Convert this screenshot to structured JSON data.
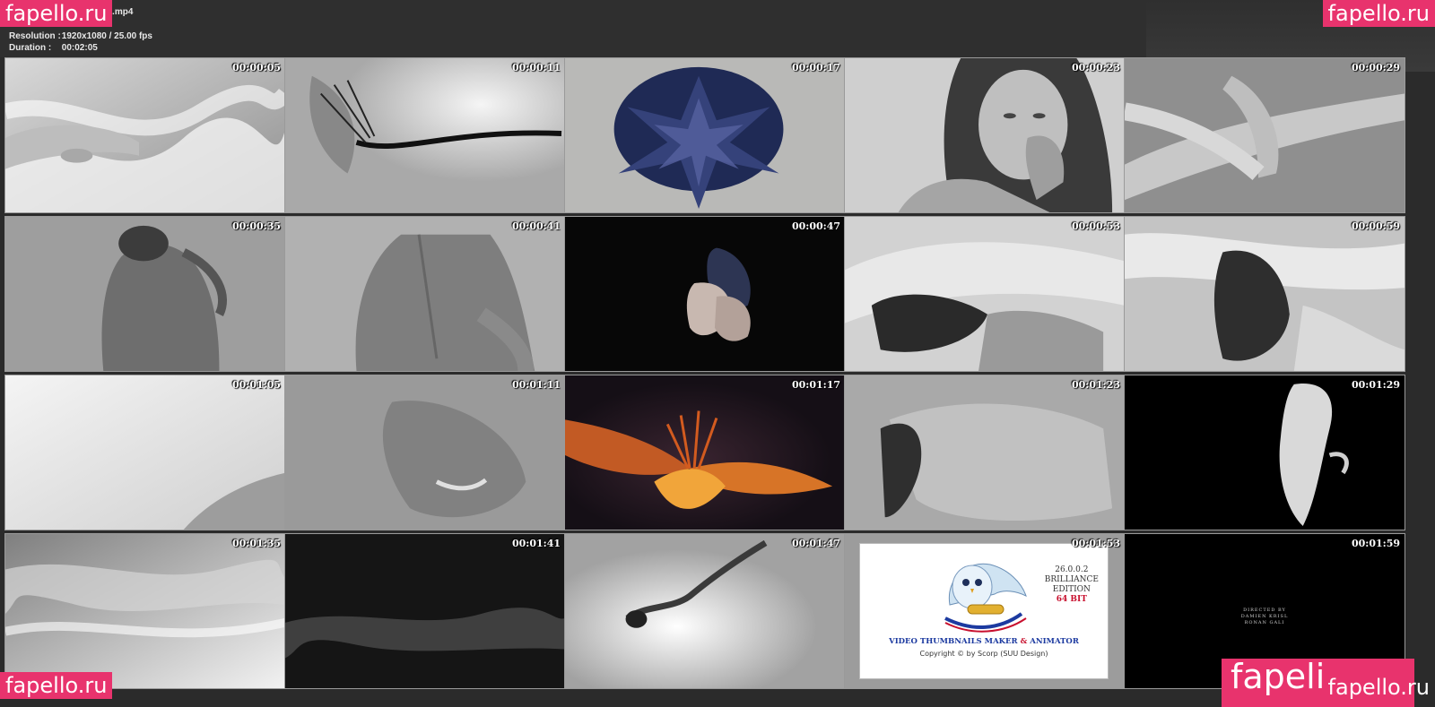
{
  "header": {
    "title": "...ayed Life - Lorena Rae.mp4",
    "resolution_label": "Resolution :",
    "resolution_value": "1920x1080 / 25.00 fps",
    "duration_label": "Duration :",
    "duration_value": "00:02:05"
  },
  "watermarks": {
    "top_left": "fapello.ru",
    "top_right": "fapello.ru",
    "bottom_left": "fapello.ru",
    "bottom_right_big": "fapeli",
    "bottom_right_small": "fapello.ru"
  },
  "thumbnails": [
    {
      "time": "00:00:05",
      "scene": "white-silk-hand"
    },
    {
      "time": "00:00:11",
      "scene": "bw-flower-stem"
    },
    {
      "time": "00:00:17",
      "scene": "blue-chrysanthemum"
    },
    {
      "time": "00:00:23",
      "scene": "bw-portrait"
    },
    {
      "time": "00:00:29",
      "scene": "bw-arms"
    },
    {
      "time": "00:00:35",
      "scene": "bw-back"
    },
    {
      "time": "00:00:41",
      "scene": "bw-back-2"
    },
    {
      "time": "00:00:47",
      "scene": "petal-on-black"
    },
    {
      "time": "00:00:53",
      "scene": "bw-fabric-face"
    },
    {
      "time": "00:00:59",
      "scene": "bw-hair-fabric"
    },
    {
      "time": "00:01:05",
      "scene": "white-haze"
    },
    {
      "time": "00:01:11",
      "scene": "grey-veil-smile"
    },
    {
      "time": "00:01:17",
      "scene": "orange-lily"
    },
    {
      "time": "00:01:23",
      "scene": "bw-veil-figure"
    },
    {
      "time": "00:01:29",
      "scene": "white-fabric-on-black"
    },
    {
      "time": "00:01:35",
      "scene": "water-surface"
    },
    {
      "time": "00:01:41",
      "scene": "dark-mist"
    },
    {
      "time": "00:01:47",
      "scene": "falling-figure"
    },
    {
      "time": "00:01:53",
      "scene": "vtm-logo"
    },
    {
      "time": "00:01:59",
      "scene": "credits-black"
    }
  ],
  "vtm_card": {
    "version": "26.0.0.2",
    "edition_1": "BRILLIANCE",
    "edition_2": "EDITION",
    "bits": "64 BIT",
    "name_part1": "VIDEO THUMBNAILS MAKER",
    "name_amp": "&",
    "name_part2": "ANIMATOR",
    "copyright": "Copyright © by Scorp (SUU Design)"
  },
  "credits": {
    "line1": "DIRECTED BY",
    "line2": "DAMIEN KRISL",
    "line3": "RONAN GALI"
  },
  "colors": {
    "background": "#2b2b2b",
    "watermark": "#e8336d",
    "thumb_border": "#9a9a9a"
  }
}
